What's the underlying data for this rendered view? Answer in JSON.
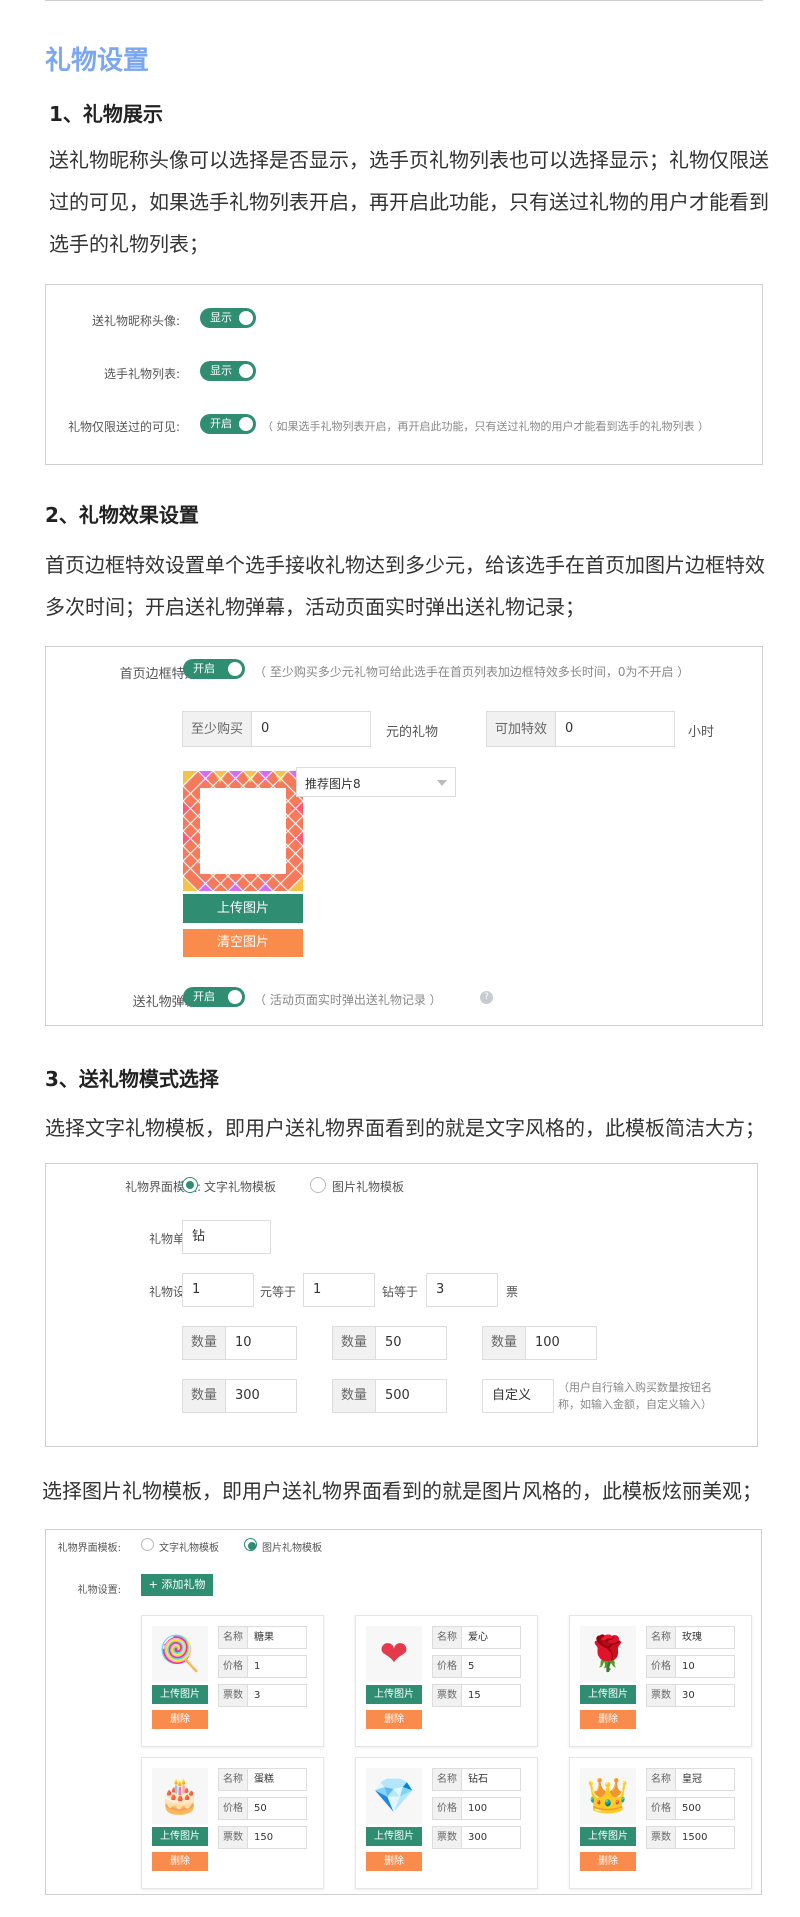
{
  "page_title": "礼物设置",
  "s1": {
    "heading": "1、礼物展示",
    "para": "送礼物昵称头像可以选择是否显示，选手页礼物列表也可以选择显示；礼物仅限送过的可见，如果选手礼物列表开启，再开启此功能，只有送过礼物的用户才能看到选手的礼物列表；",
    "rows": [
      {
        "label": "送礼物昵称头像:",
        "toggle": "显示"
      },
      {
        "label": "选手礼物列表:",
        "toggle": "显示"
      },
      {
        "label": "礼物仅限送过的可见:",
        "toggle": "开启",
        "hint": "（ 如果选手礼物列表开启，再开启此功能，只有送过礼物的用户才能看到选手的礼物列表 ）"
      }
    ]
  },
  "s2": {
    "heading": "2、礼物效果设置",
    "para": "首页边框特效设置单个选手接收礼物达到多少元，给该选手在首页加图片边框特效多次时间；开启送礼物弹幕，活动页面实时弹出送礼物记录；",
    "frame_label": "首页边框特效:",
    "frame_toggle": "开启",
    "frame_hint": "（ 至少购买多少元礼物可给此选手在首页列表加边框特效多长时间，0为不开启 ）",
    "min_buy_label": "至少购买",
    "min_buy_value": "0",
    "yuan_gift": "元的礼物",
    "extra_label": "可加特效",
    "extra_value": "0",
    "hours": "小时",
    "select_value": "推荐图片8",
    "upload_btn": "上传图片",
    "clear_btn": "清空图片",
    "barrage_label": "送礼物弹幕:",
    "barrage_toggle": "开启",
    "barrage_hint": "（ 活动页面实时弹出送礼物记录 ）"
  },
  "s3": {
    "heading": "3、送礼物模式选择",
    "para1": "选择文字礼物模板，即用户送礼物界面看到的就是文字风格的，此模板简洁大方；",
    "tpl_label": "礼物界面模板:",
    "tpl_text": "文字礼物模板",
    "tpl_image": "图片礼物模板",
    "unit_label": "礼物单位:",
    "unit_value": "钻",
    "setting_label": "礼物设置:",
    "v1": "1",
    "yuan_eq": "元等于",
    "v2": "1",
    "zuan_eq": "钻等于",
    "v3": "3",
    "piao": "票",
    "qty_label": "数量",
    "qty": [
      "10",
      "50",
      "100",
      "300",
      "500"
    ],
    "custom": "自定义",
    "custom_hint1": "（用户自行输入购买数量按钮名",
    "custom_hint2": "称，如输入金额，自定义输入）",
    "para2": "选择图片礼物模板，即用户送礼物界面看到的就是图片风格的，此模板炫丽美观；",
    "img_panel": {
      "tpl_label": "礼物界面模板:",
      "tpl_text": "文字礼物模板",
      "tpl_image": "图片礼物模板",
      "setting_label": "礼物设置:",
      "add_btn": "+ 添加礼物",
      "f_name": "名称",
      "f_price": "价格",
      "f_votes": "票数",
      "upload": "上传图片",
      "delete": "删除",
      "gifts": [
        {
          "name": "糖果",
          "price": "1",
          "votes": "3",
          "icon": "candy-icon",
          "glyph": "🍭"
        },
        {
          "name": "爱心",
          "price": "5",
          "votes": "15",
          "icon": "heart-icon",
          "glyph": "❤"
        },
        {
          "name": "玫瑰",
          "price": "10",
          "votes": "30",
          "icon": "rose-icon",
          "glyph": "🌹"
        },
        {
          "name": "蛋糕",
          "price": "50",
          "votes": "150",
          "icon": "cake-icon",
          "glyph": "🎂"
        },
        {
          "name": "钻石",
          "price": "100",
          "votes": "300",
          "icon": "diamond-icon",
          "glyph": "💎"
        },
        {
          "name": "皇冠",
          "price": "500",
          "votes": "1500",
          "icon": "crown-icon",
          "glyph": "👑"
        }
      ]
    }
  },
  "colors": {
    "accent": "#2f8d72",
    "orange": "#f98b4c",
    "title": "#7aa7ef"
  }
}
